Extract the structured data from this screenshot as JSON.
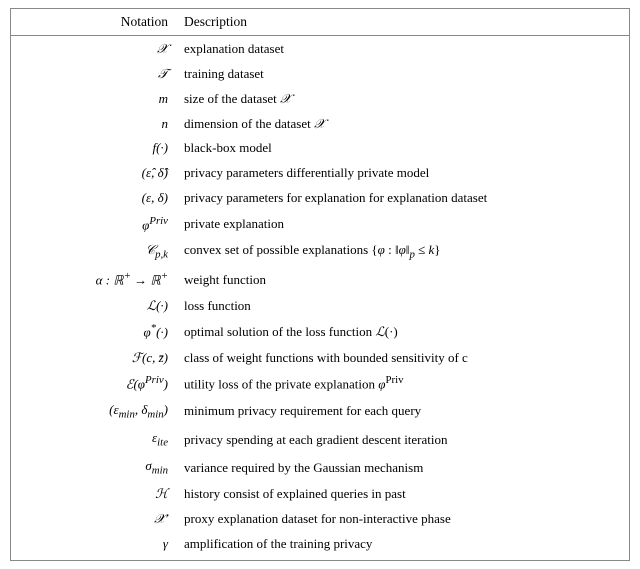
{
  "table": {
    "header": {
      "notation": "Notation",
      "description": "Description"
    },
    "rows": [
      {
        "notation_html": "&#x1D4B3;",
        "notation_text": "𝒳",
        "description": "explanation dataset"
      },
      {
        "notation_html": "&#x1D4AF;",
        "notation_text": "𝒯",
        "description": "training dataset"
      },
      {
        "notation_html": "m",
        "notation_text": "m",
        "description": "size of the dataset 𝒳"
      },
      {
        "notation_html": "n",
        "notation_text": "n",
        "description": "dimension of the dataset 𝒳"
      },
      {
        "notation_html": "f(·)",
        "notation_text": "f(·)",
        "description": "black-box model"
      },
      {
        "notation_html": "(ε̂, δ̂)",
        "notation_text": "(ε̂, δ̂)",
        "description": "privacy parameters differentially private model"
      },
      {
        "notation_html": "(ε, δ)",
        "notation_text": "(ε, δ)",
        "description": "privacy parameters for explanation for explanation dataset"
      },
      {
        "notation_html": "φ<sup>Priv</sup>",
        "notation_text": "φ^Priv",
        "description": "private explanation"
      },
      {
        "notation_html": "𝒞<sub>p,k</sub>",
        "notation_text": "C_p,k",
        "description": "convex set of possible explanations {φ : ‖φ‖ₚ ≤ k}"
      },
      {
        "notation_html": "α : ℝ<sup>+</sup> → ℝ<sup>+</sup>",
        "notation_text": "α : ℝ⁺ → ℝ⁺",
        "description": "weight function"
      },
      {
        "notation_html": "ℒ(·)",
        "notation_text": "ℒ(·)",
        "description": "loss function"
      },
      {
        "notation_html": "φ<sup>*</sup>(·)",
        "notation_text": "φ*(·)",
        "description": "optimal solution of the loss function ℒ(·)"
      },
      {
        "notation_html": "ℱ(c, z̄)",
        "notation_text": "ℱ(c, z̄)",
        "description": "class of weight functions with bounded sensitivity of c"
      },
      {
        "notation_html": "ℰ(φ<sup>Priv</sup>)",
        "notation_text": "ℰ(φ^Priv)",
        "description": "utility loss of the private explanation φ^Priv"
      },
      {
        "notation_html": "(ε<sub>min</sub>, δ<sub>min</sub>)",
        "notation_text": "(ε_min, δ_min)",
        "description": "minimum privacy requirement for each query"
      },
      {
        "notation_html": "ε<sub>ite</sub>",
        "notation_text": "ε_ite",
        "description": "privacy spending at each gradient descent iteration"
      },
      {
        "notation_html": "σ<sub>min</sub>",
        "notation_text": "σ_min",
        "description": "variance required by the Gaussian mechanism"
      },
      {
        "notation_html": "ℋ",
        "notation_text": "ℋ",
        "description": "history consist of explained queries in past"
      },
      {
        "notation_html": "𝒳′",
        "notation_text": "𝒳′",
        "description": "proxy explanation dataset for non-interactive phase"
      },
      {
        "notation_html": "γ",
        "notation_text": "γ",
        "description": "amplification of the training privacy"
      }
    ]
  }
}
